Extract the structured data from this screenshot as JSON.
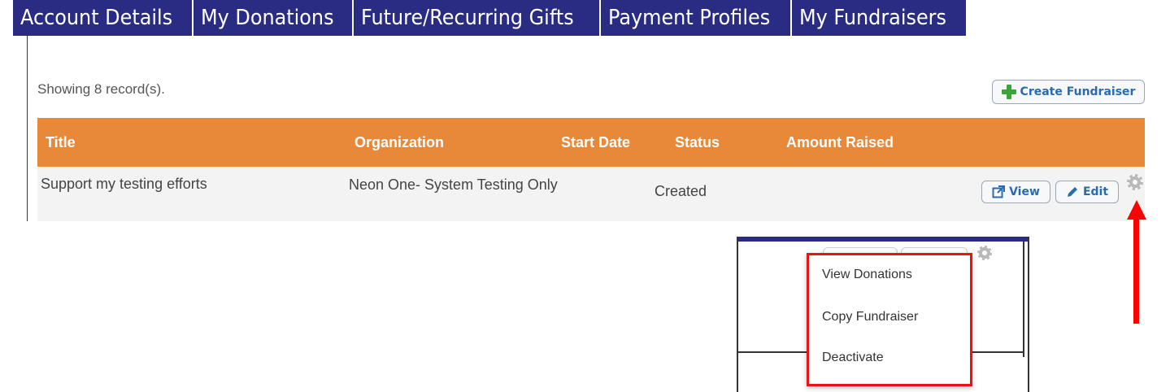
{
  "tabs": [
    {
      "label": "Account Details"
    },
    {
      "label": "My Donations"
    },
    {
      "label": "Future/Recurring Gifts"
    },
    {
      "label": "Payment Profiles"
    },
    {
      "label": "My Fundraisers"
    }
  ],
  "records_text": "Showing 8 record(s).",
  "create_button": "Create Fundraiser",
  "table": {
    "headers": {
      "title": "Title",
      "organization": "Organization",
      "start_date": "Start Date",
      "status": "Status",
      "amount_raised": "Amount Raised"
    },
    "rows": [
      {
        "title": "Support my testing efforts",
        "organization": "Neon One- System Testing Only",
        "start_date": "",
        "status": "Created",
        "amount_raised": "",
        "view_label": "View",
        "edit_label": "Edit"
      }
    ]
  },
  "dropdown_menu": {
    "items": [
      "View Donations",
      "Copy Fundraiser",
      "Deactivate"
    ]
  },
  "colors": {
    "tab_bg": "#2a2c83",
    "header_bg": "#e8893a",
    "annotation": "#ff0000"
  }
}
